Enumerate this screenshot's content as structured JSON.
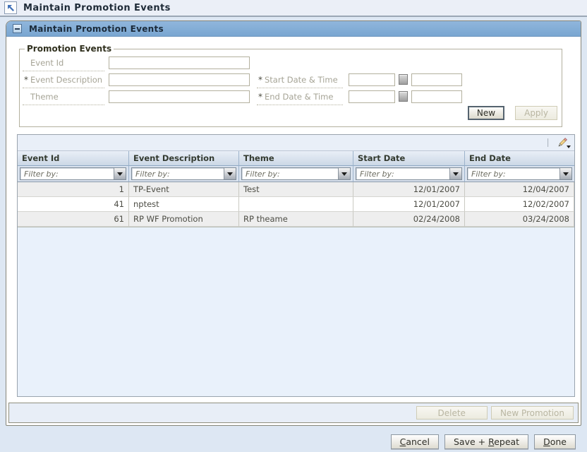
{
  "window": {
    "title": "Maintain Promotion Events"
  },
  "panel": {
    "title": "Maintain Promotion Events"
  },
  "form": {
    "legend": "Promotion Events",
    "required_marker": "*",
    "fields": {
      "event_id": {
        "label": "Event Id",
        "required": false,
        "value": ""
      },
      "event_description": {
        "label": "Event Description",
        "required": true,
        "value": ""
      },
      "theme": {
        "label": "Theme",
        "required": false,
        "value": ""
      },
      "start_datetime": {
        "label": "Start Date & Time",
        "required": true,
        "date_value": "",
        "time_value": ""
      },
      "end_datetime": {
        "label": "End Date & Time",
        "required": true,
        "date_value": "",
        "time_value": ""
      }
    },
    "buttons": {
      "new": "New",
      "apply": "Apply",
      "apply_enabled": false
    }
  },
  "table": {
    "columns": [
      {
        "label": "Event Id"
      },
      {
        "label": "Event Description"
      },
      {
        "label": "Theme"
      },
      {
        "label": "Start Date"
      },
      {
        "label": "End Date"
      }
    ],
    "filter_placeholder": "Filter by:",
    "rows": [
      {
        "event_id": "1",
        "event_description": "TP-Event",
        "theme": "Test",
        "start_date": "12/01/2007",
        "end_date": "12/04/2007"
      },
      {
        "event_id": "41",
        "event_description": "nptest",
        "theme": "",
        "start_date": "12/01/2007",
        "end_date": "12/02/2007"
      },
      {
        "event_id": "61",
        "event_description": "RP WF Promotion",
        "theme": "RP theame",
        "start_date": "02/24/2008",
        "end_date": "03/24/2008"
      }
    ],
    "toolbar": {
      "edit_icon": "pencil-icon"
    }
  },
  "footer": {
    "delete_label": "Delete",
    "new_promotion_label": "New Promotion",
    "delete_enabled": false,
    "new_promotion_enabled": false
  },
  "actions": {
    "cancel": {
      "pre": "",
      "key": "C",
      "post": "ancel"
    },
    "save_repeat": {
      "pre": "Save + ",
      "key": "R",
      "post": "epeat"
    },
    "done": {
      "pre": "",
      "key": "D",
      "post": "one"
    }
  },
  "colors": {
    "panel_header_blue": "#7FA9D1",
    "page_background": "#DDE7F3",
    "grid_header_blue": "#CCD8E6",
    "row_alt_gray": "#EEEEEE",
    "disabled_text": "#B9B6A2",
    "titlebar_background": "#EBEFF7"
  }
}
